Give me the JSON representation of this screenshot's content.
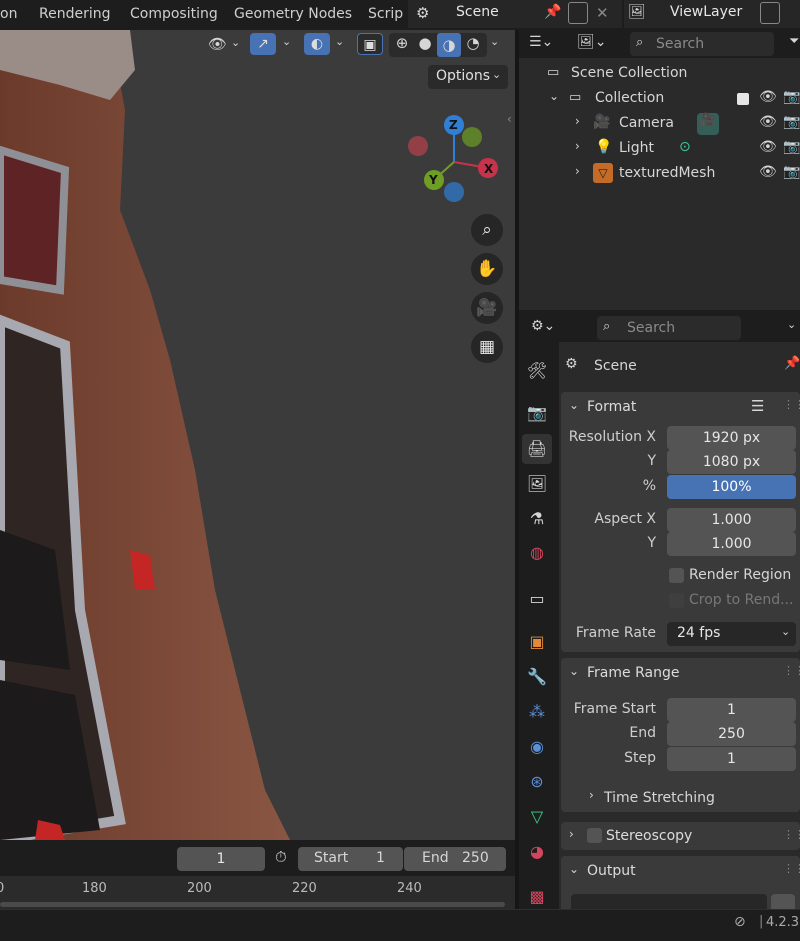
{
  "top_menu": [
    "on",
    "Rendering",
    "Compositing",
    "Geometry Nodes",
    "Scrip"
  ],
  "scene_name": "Scene",
  "view_layer": "ViewLayer",
  "viewport": {
    "options_label": "Options",
    "gizmo": {
      "z": "Z",
      "y": "Y",
      "x": "X"
    }
  },
  "outliner": {
    "search_placeholder": "Search",
    "items": [
      {
        "label": "Scene Collection"
      },
      {
        "label": "Collection"
      },
      {
        "label": "Camera"
      },
      {
        "label": "Light"
      },
      {
        "label": "texturedMesh"
      }
    ]
  },
  "properties": {
    "search_placeholder": "Search",
    "context_label": "Scene",
    "format": {
      "title": "Format",
      "resolution_x_label": "Resolution X",
      "resolution_x": "1920 px",
      "y_label": "Y",
      "resolution_y": "1080 px",
      "percent_label": "%",
      "percent": "100%",
      "aspect_x_label": "Aspect X",
      "aspect_x": "1.000",
      "aspect_y_label": "Y",
      "aspect_y": "1.000",
      "render_region": "Render Region",
      "crop": "Crop to Rend...",
      "frame_rate_label": "Frame Rate",
      "frame_rate": "24 fps"
    },
    "frame_range": {
      "title": "Frame Range",
      "start_label": "Frame Start",
      "start": "1",
      "end_label": "End",
      "end": "250",
      "step_label": "Step",
      "step": "1",
      "time_stretching": "Time Stretching"
    },
    "stereoscopy": "Stereoscopy",
    "output": "Output"
  },
  "timeline": {
    "current_frame": "1",
    "start_label": "Start",
    "start": "1",
    "end_label": "End",
    "end": "250",
    "ruler": [
      "0",
      "180",
      "200",
      "220",
      "240"
    ]
  },
  "status": {
    "version": "4.2.3"
  },
  "colors": {
    "accent_blue": "#4772b3",
    "gizmo_x": "#c9324b",
    "gizmo_y": "#6f9e24",
    "gizmo_z": "#2f7fd6"
  }
}
